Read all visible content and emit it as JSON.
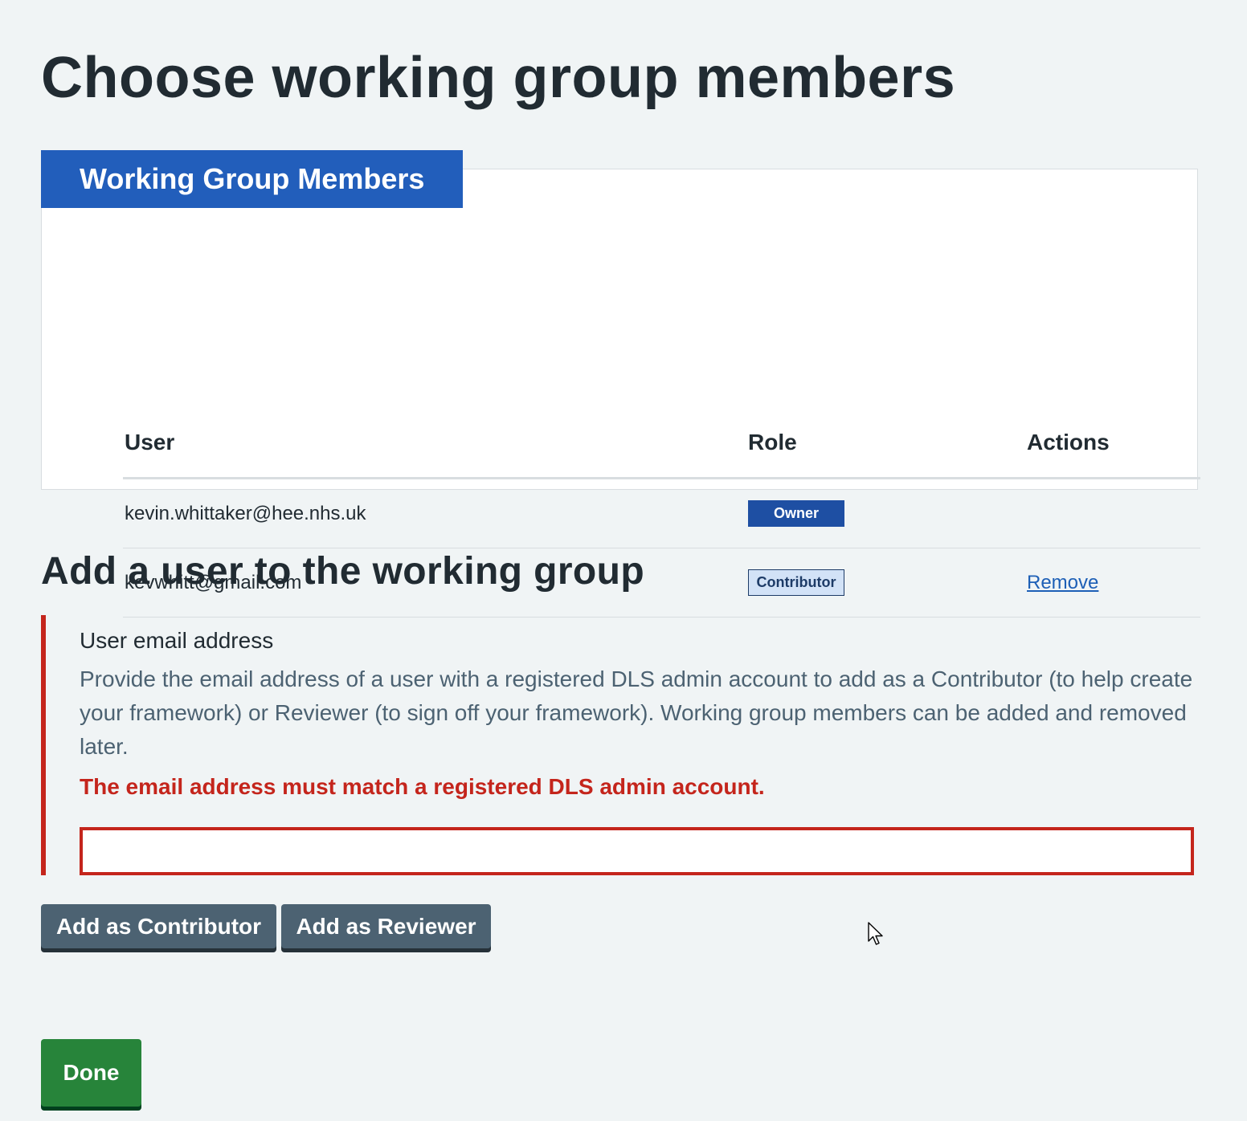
{
  "page": {
    "title": "Choose working group members"
  },
  "members_card": {
    "heading": "Working Group Members",
    "columns": {
      "user": "User",
      "role": "Role",
      "actions": "Actions"
    },
    "rows": [
      {
        "user": "kevin.whittaker@hee.nhs.uk",
        "role": "Owner",
        "action": ""
      },
      {
        "user": "kevwhitt@gmail.com",
        "role": "Contributor",
        "action": "Remove"
      }
    ]
  },
  "add_user": {
    "title": "Add a user to the working group",
    "field_label": "User email address",
    "hint": "Provide the email address of a user with a registered DLS admin account to add as a Contributor (to help create your framework) or Reviewer (to sign off your framework). Working group members can be added and removed later.",
    "error": "The email address must match a registered DLS admin account.",
    "email_value": "",
    "add_contributor_label": "Add as Contributor",
    "add_reviewer_label": "Add as Reviewer"
  },
  "done_label": "Done",
  "colors": {
    "background": "#f0f4f5",
    "heading_tab": "#225ebb",
    "error": "#c4251c",
    "secondary_button": "#4c6272",
    "done_button": "#27843a",
    "link": "#1d5fb6"
  },
  "icons": {
    "cursor": "mouse-pointer-icon"
  }
}
